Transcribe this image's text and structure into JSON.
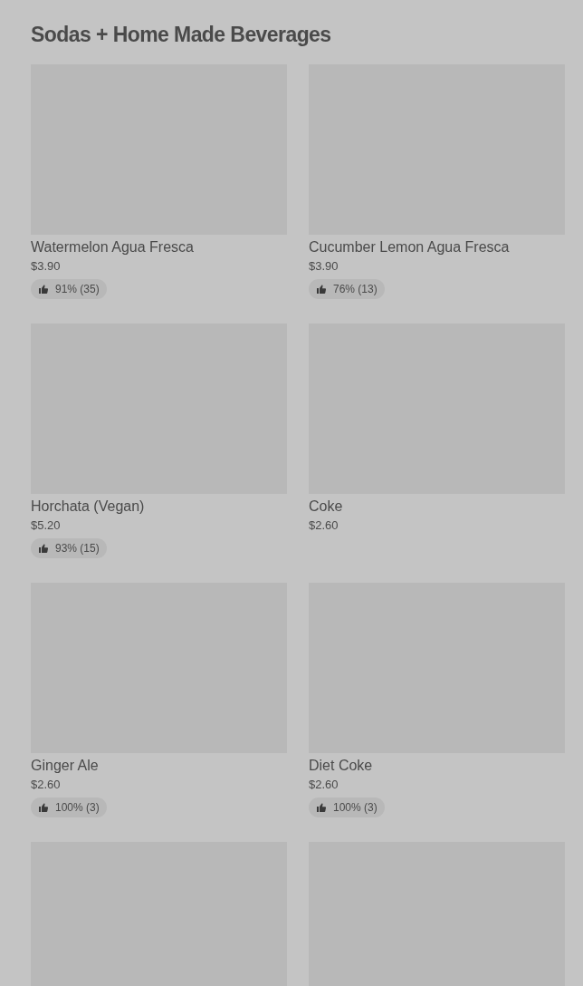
{
  "section": {
    "title": "Sodas + Home Made Beverages"
  },
  "items": [
    {
      "kind": "product",
      "name": "Watermelon Agua Fresca",
      "price": "$3.90",
      "rating": "91% (35)"
    },
    {
      "kind": "product",
      "name": "Cucumber Lemon Agua Fresca",
      "price": "$3.90",
      "rating": "76% (13)"
    },
    {
      "kind": "product",
      "name": "Horchata (Vegan)",
      "price": "$5.20",
      "rating": "93% (15)"
    },
    {
      "kind": "product",
      "name": "Coke",
      "price": "$2.60"
    },
    {
      "kind": "product",
      "name": "Ginger Ale",
      "price": "$2.60",
      "rating": "100% (3)"
    },
    {
      "kind": "product",
      "name": "Diet Coke",
      "price": "$2.60",
      "rating": "100% (3)"
    },
    {
      "kind": "picture"
    },
    {
      "kind": "picture"
    }
  ]
}
